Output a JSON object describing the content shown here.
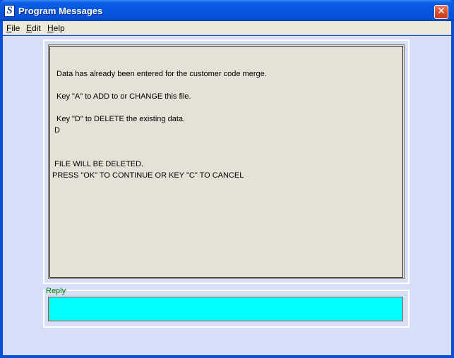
{
  "window": {
    "title": "Program Messages",
    "icon_letter": "S",
    "close_glyph": "✕"
  },
  "menu": {
    "items": [
      {
        "label_ul": "F",
        "label_rest": "ile"
      },
      {
        "label_ul": "E",
        "label_rest": "dit"
      },
      {
        "label_ul": "H",
        "label_rest": "elp"
      }
    ]
  },
  "message": {
    "lines": [
      "Data has already been entered for the customer code merge.",
      "Key \"A\" to ADD to or CHANGE this file.",
      "Key \"D\" to DELETE the existing data.",
      "D",
      "FILE WILL BE DELETED.",
      "PRESS \"OK\" TO CONTINUE OR KEY \"C\" TO CANCEL"
    ]
  },
  "reply": {
    "label": "Reply",
    "value": ""
  },
  "colors": {
    "titlebar": "#0656e0",
    "client_background": "#d6def8",
    "message_background": "#e5e1d6",
    "reply_input_background": "#00ffff",
    "reply_label": "#008000"
  }
}
